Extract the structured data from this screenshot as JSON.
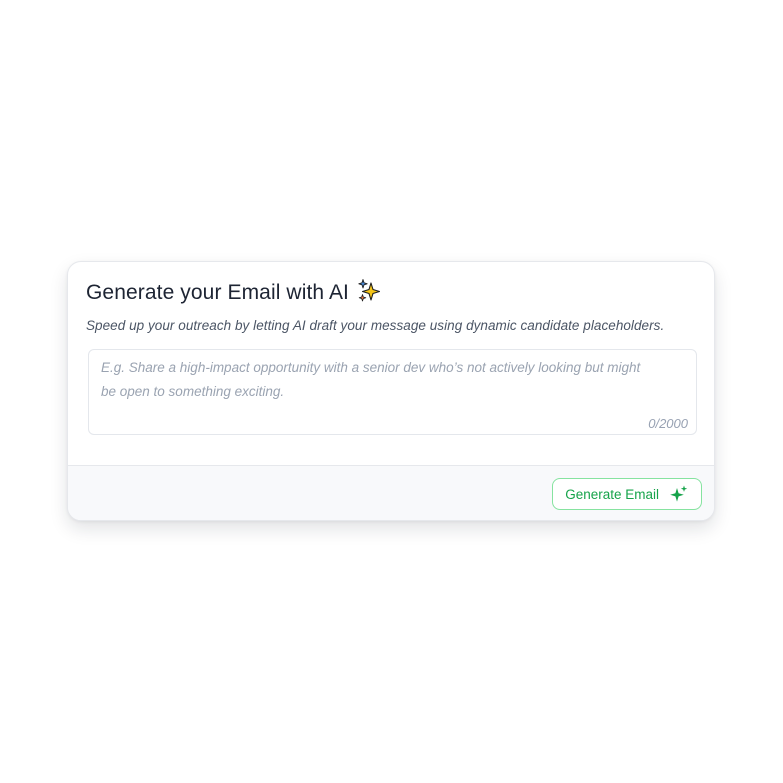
{
  "card": {
    "title": "Generate your Email with AI",
    "title_icon": "sparkles-emoji-icon",
    "subtitle": "Speed up your outreach by letting AI draft your message using dynamic candidate placeholders.",
    "prompt": {
      "value": "",
      "placeholder": "E.g. Share a high-impact opportunity with a senior dev who’s not actively looking but might be open to something exciting.",
      "counter": "0/2000"
    },
    "footer": {
      "generate_label": "Generate Email",
      "generate_icon": "sparkle-icon"
    }
  },
  "colors": {
    "accent": "#16a34a",
    "accent_border": "#86e3a0",
    "footer_bg": "#f8f9fb",
    "title": "#1d2433",
    "muted": "#9aa3b1"
  }
}
